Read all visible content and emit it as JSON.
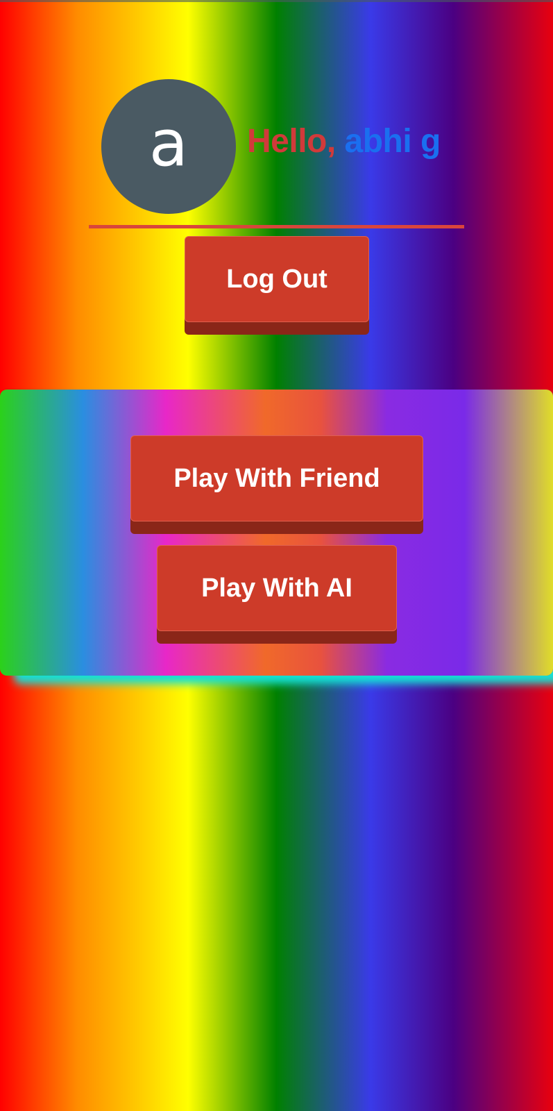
{
  "user": {
    "avatar_letter": "a",
    "greeting_prefix": "Hello,",
    "name": "abhi g"
  },
  "account": {
    "logout_label": "Log Out"
  },
  "game_menu": {
    "play_friend_label": "Play With Friend",
    "play_ai_label": "Play With AI"
  },
  "colors": {
    "button": "#cd3b29",
    "button_shadow": "#8a2618",
    "avatar": "#4a5a63",
    "greeting_prefix": "#d13a3a",
    "greeting_name": "#1a6ff0",
    "divider": "#d9453c",
    "panel_shadow": "#16e0d4"
  }
}
